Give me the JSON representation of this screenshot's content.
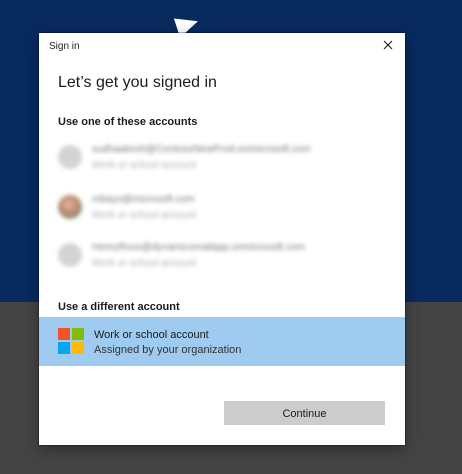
{
  "window": {
    "title": "Sign in",
    "close_icon": "close-icon"
  },
  "heading": "Let’s get you signed in",
  "existing_accounts": {
    "label": "Use one of these accounts",
    "items": [
      {
        "email": "sudhaakesh@ContosoNewProd.onmicrosoft.com",
        "type": "Work or school account",
        "avatar": "person-icon"
      },
      {
        "email": "mbayo@microsoft.com",
        "type": "Work or school account",
        "avatar": "photo"
      },
      {
        "email": "HenryRoss@dynamicsmailapp.onmicrosoft.com",
        "type": "Work or school account",
        "avatar": "person-icon"
      }
    ]
  },
  "different_account": {
    "label": "Use a different account",
    "option_title": "Work or school account",
    "option_subtitle": "Assigned by your organization",
    "logo": "microsoft-logo-icon"
  },
  "continue_label": "Continue",
  "colors": {
    "background_top": "#082a5e",
    "background_bottom": "#444444",
    "selected_row": "#9ecbef",
    "button": "#cccccc",
    "ms_red": "#f35325",
    "ms_green": "#81bc06",
    "ms_blue": "#05a6f0",
    "ms_yellow": "#ffba08"
  }
}
